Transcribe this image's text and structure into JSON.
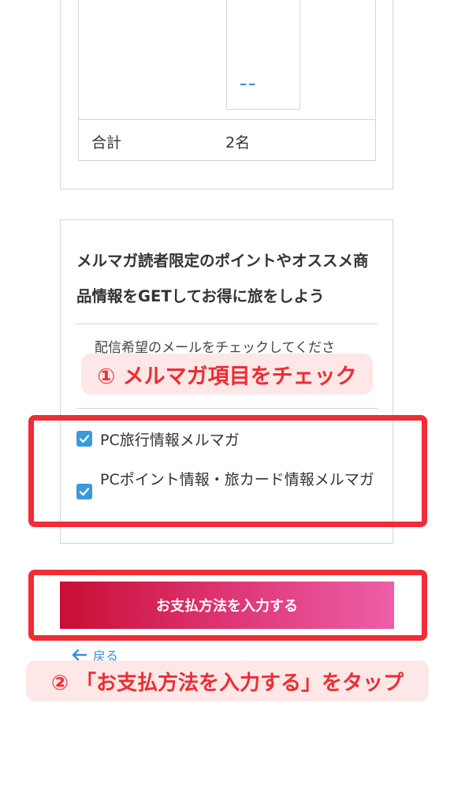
{
  "summary_table": {
    "total_label": "合計",
    "total_value": "2名"
  },
  "mail_magazine": {
    "heading": "メルマガ読者限定のポイントやオススメ商品情報をGETしてお得に旅をしよう",
    "instruction": "配信希望のメールをチェックしてくださ",
    "options": [
      {
        "label": "PC旅行情報メルマガ",
        "checked": true
      },
      {
        "label": "PCポイント情報・旅カード情報メルマガ",
        "checked": true
      }
    ]
  },
  "actions": {
    "submit_label": "お支払方法を入力する",
    "back_label": "戻る"
  },
  "annotations": {
    "step1": "① メルマガ項目をチェック",
    "step2": "② 「お支払方法を入力する」をタップ"
  },
  "colors": {
    "accent_red": "#ee2d34",
    "checkbox_blue": "#3b9ad9",
    "link_blue": "#3b8fd6",
    "button_gradient_start": "#c80f34",
    "button_gradient_end": "#ec5fa8"
  },
  "icons": {
    "checkbox": "checkmark-icon",
    "back": "arrow-left-icon"
  }
}
